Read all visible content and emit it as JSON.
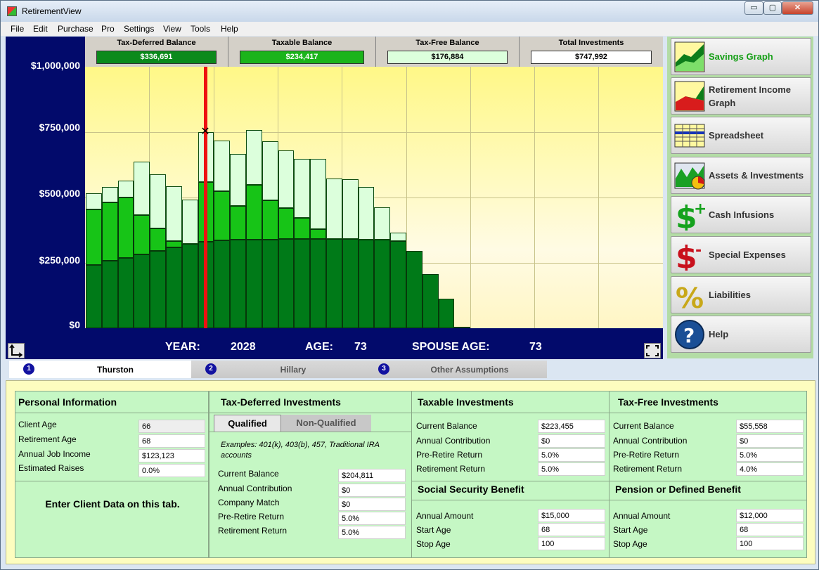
{
  "window": {
    "title": "RetirementView",
    "min_label": "▭",
    "max_label": "▢",
    "close_label": "✕"
  },
  "menu": [
    "File",
    "Edit",
    "Purchase",
    "Pro",
    "Settings",
    "View",
    "Tools",
    "Help"
  ],
  "summary": [
    {
      "label": "Tax-Deferred Balance",
      "value": "$336,691",
      "color": "#0b8a1c"
    },
    {
      "label": "Taxable Balance",
      "value": "$234,417",
      "color": "#1bb41b"
    },
    {
      "label": "Tax-Free Balance",
      "value": "$176,884",
      "color": "#dcffdc"
    },
    {
      "label": "Total Investments",
      "value": "$747,992",
      "color": "#ffffff"
    }
  ],
  "y_axis": [
    "$1,000,000",
    "$750,000",
    "$500,000",
    "$250,000",
    "$0"
  ],
  "chart_data": {
    "type": "bar",
    "stacked": true,
    "ylim": [
      0,
      1000000
    ],
    "y_ticks": [
      "$1,000,000",
      "$750,000",
      "$500,000",
      "$250,000",
      "$0"
    ],
    "series": [
      {
        "values": [
          242000,
          258000,
          268000,
          282000,
          296000,
          310000,
          322000,
          332000,
          336000,
          338000,
          339000,
          340000,
          341000,
          342000,
          342000,
          342000,
          341000,
          340000,
          338000,
          333000,
          295000,
          207000,
          113000,
          5000
        ]
      },
      {
        "values": [
          213000,
          222000,
          232000,
          150000,
          87000,
          23000,
          0,
          227000,
          188000,
          130000,
          210000,
          150000,
          120000,
          80000,
          37000,
          0,
          0,
          0,
          0,
          0,
          0,
          0,
          0,
          0
        ]
      },
      {
        "values": [
          60000,
          60000,
          65000,
          205000,
          205000,
          210000,
          170000,
          190000,
          195000,
          200000,
          210000,
          225000,
          220000,
          225000,
          270000,
          230000,
          230000,
          200000,
          125000,
          33000,
          0,
          0,
          0,
          0
        ]
      }
    ],
    "marker_index": 7
  },
  "footer": {
    "year_label": "YEAR:",
    "year": "2028",
    "age_label": "AGE:",
    "age": "73",
    "spouse_label": "SPOUSE AGE:",
    "spouse": "73"
  },
  "side": [
    {
      "label": "Savings Graph",
      "icon": "savings-graph-icon"
    },
    {
      "label": "Retirement Income Graph",
      "icon": "retirement-income-graph-icon"
    },
    {
      "label": "Spreadsheet",
      "icon": "spreadsheet-icon"
    },
    {
      "label": "Assets & Investments",
      "icon": "assets-icon"
    },
    {
      "label": "Cash Infusions",
      "icon": "cash-infusions-icon"
    },
    {
      "label": "Special Expenses",
      "icon": "special-expenses-icon"
    },
    {
      "label": "Liabilities",
      "icon": "liabilities-icon"
    },
    {
      "label": "Help",
      "icon": "help-icon"
    }
  ],
  "tabs": [
    {
      "num": "1",
      "label": "Thurston"
    },
    {
      "num": "2",
      "label": "Hillary"
    },
    {
      "num": "3",
      "label": "Other Assumptions"
    }
  ],
  "personal": {
    "title": "Personal Information",
    "rows": [
      {
        "label": "Client Age",
        "value": "66"
      },
      {
        "label": "Retirement Age",
        "value": "68"
      },
      {
        "label": "Annual Job Income",
        "value": "$123,123"
      },
      {
        "label": "Estimated Raises",
        "value": "0.0%"
      }
    ],
    "note": "Enter Client Data on this tab."
  },
  "taxdeferred": {
    "title": "Tax-Deferred Investments",
    "tab1": "Qualified",
    "tab2": "Non-Qualified",
    "examples": "Examples: 401(k), 403(b), 457, Traditional IRA accounts",
    "rows": [
      {
        "label": "Current Balance",
        "value": "$204,811"
      },
      {
        "label": "Annual Contribution",
        "value": "$0"
      },
      {
        "label": "Company Match",
        "value": "$0"
      },
      {
        "label": "Pre-Retire Return",
        "value": "5.0%"
      },
      {
        "label": "Retirement Return",
        "value": "5.0%"
      }
    ]
  },
  "taxable": {
    "title": "Taxable Investments",
    "rows": [
      {
        "label": "Current Balance",
        "value": "$223,455"
      },
      {
        "label": "Annual Contribution",
        "value": "$0"
      },
      {
        "label": "Pre-Retire Return",
        "value": "5.0%"
      },
      {
        "label": "Retirement Return",
        "value": "5.0%"
      }
    ]
  },
  "taxfree": {
    "title": "Tax-Free Investments",
    "rows": [
      {
        "label": "Current Balance",
        "value": "$55,558"
      },
      {
        "label": "Annual Contribution",
        "value": "$0"
      },
      {
        "label": "Pre-Retire Return",
        "value": "5.0%"
      },
      {
        "label": "Retirement Return",
        "value": "4.0%"
      }
    ]
  },
  "ss": {
    "title": "Social Security Benefit",
    "rows": [
      {
        "label": "Annual Amount",
        "value": "$15,000"
      },
      {
        "label": "Start Age",
        "value": "68"
      },
      {
        "label": "Stop Age",
        "value": "100"
      }
    ]
  },
  "pension": {
    "title": "Pension or Defined Benefit",
    "rows": [
      {
        "label": "Annual Amount",
        "value": "$12,000"
      },
      {
        "label": "Start Age",
        "value": "68"
      },
      {
        "label": "Stop Age",
        "value": "100"
      }
    ]
  }
}
